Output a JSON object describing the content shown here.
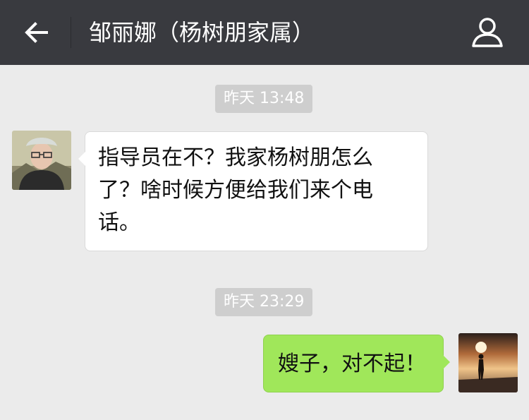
{
  "header": {
    "title": "邹丽娜（杨树朋家属）",
    "back_icon": "arrow-left-icon",
    "profile_icon": "person-icon",
    "background": "#393a3f"
  },
  "messages": [
    {
      "time": "昨天 13:48"
    },
    {
      "lines": [
        "指导员在不？我家杨树朋怎么",
        "了？啥时候方便给我们来个电",
        "话。"
      ]
    },
    {
      "time": "昨天 23:29"
    },
    {
      "text": "嫂子，对不起！"
    }
  ],
  "colors": {
    "chat_background": "#ebebeb",
    "incoming_bubble": "#ffffff",
    "outgoing_bubble": "#a0e75a",
    "timestamp_pill": "#cecece"
  }
}
